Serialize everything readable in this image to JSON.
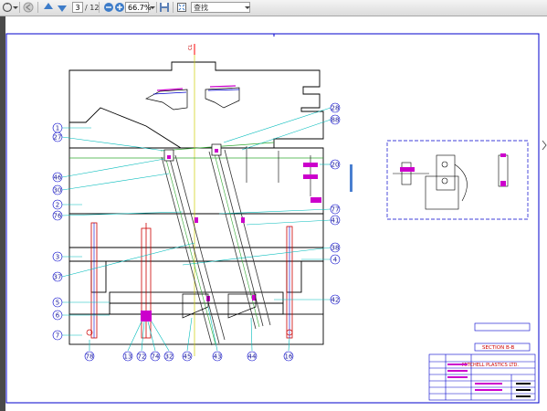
{
  "toolbar": {
    "page_current": "3",
    "page_total": "/ 12",
    "zoom": "66.7%",
    "find_placeholder": "查找"
  },
  "drawing": {
    "callouts": {
      "c1": "1",
      "c27": "27",
      "c46": "46",
      "c30": "30",
      "c2": "2",
      "c76": "76",
      "c3": "3",
      "c37": "37",
      "c5": "5",
      "c6": "6",
      "c7": "7",
      "c28": "28",
      "c88": "88",
      "c20": "20",
      "c77": "77",
      "c41": "41",
      "c38": "38",
      "c4": "4",
      "c42": "42",
      "b78": "78",
      "b13": "13",
      "b72": "72",
      "b74": "74",
      "b32": "32",
      "b45": "45",
      "b43": "43",
      "b44": "44",
      "b16": "16"
    },
    "section_label": "SECTION B-B",
    "company": "MITCHELL PLASTICS LTD."
  }
}
